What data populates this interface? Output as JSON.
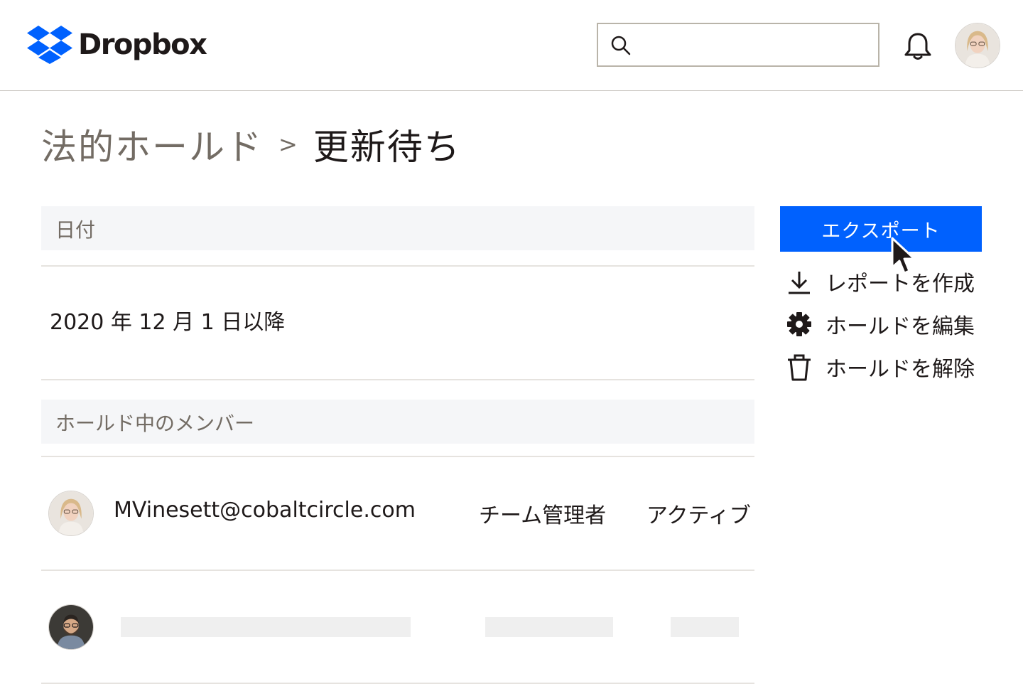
{
  "header": {
    "brand": "Dropbox",
    "search": {
      "value": "",
      "placeholder": ""
    },
    "icons": [
      "dropbox-logo-icon",
      "search-icon",
      "bell-icon",
      "user-avatar"
    ]
  },
  "breadcrumb": {
    "parent": "法的ホールド",
    "separator": ">",
    "current": "更新待ち"
  },
  "date_section": {
    "header": "日付",
    "value": "2020 年 12 月 1 日以降"
  },
  "members_section": {
    "header": "ホールド中のメンバー",
    "members": [
      {
        "email": "MVinesett@cobaltcircle.com",
        "role": "チーム管理者",
        "status": "アクティブ"
      }
    ]
  },
  "actions": {
    "export_label": "エクスポート",
    "items": [
      {
        "label": "レポートを作成",
        "icon": "download-icon"
      },
      {
        "label": "ホールドを編集",
        "icon": "gear-icon"
      },
      {
        "label": "ホールドを解除",
        "icon": "trash-icon"
      }
    ]
  },
  "colors": {
    "accent": "#0061fe",
    "text": "#1e1919",
    "muted_text": "#736c64",
    "section_bg": "#f5f6f8",
    "divider": "#e6e3df"
  }
}
